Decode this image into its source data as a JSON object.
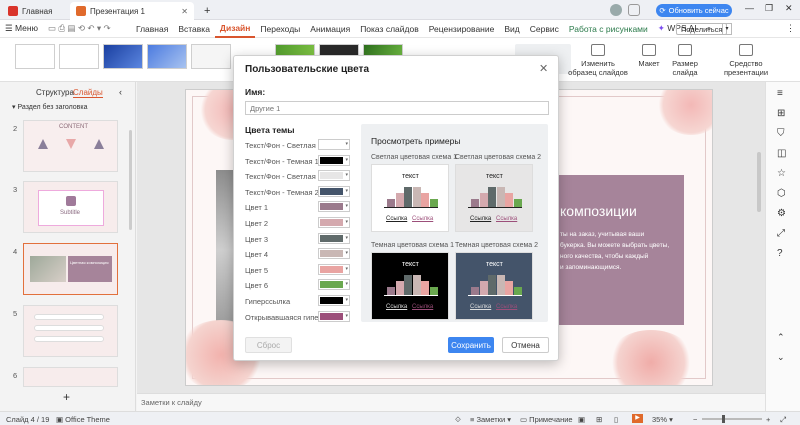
{
  "titlebar": {
    "home_tab": "Главная",
    "doc_tab": "Презентация 1",
    "update_button": "Обновить сейчас",
    "share_button": "Поделиться"
  },
  "menubar": {
    "menu_label": "Меню",
    "items": [
      "Главная",
      "Вставка",
      "Дизайн",
      "Переходы",
      "Анимация",
      "Показ слайдов",
      "Рецензирование",
      "Вид",
      "Сервис",
      "Работа с рисунками",
      "WPS AI"
    ]
  },
  "ribbon": {
    "change_scheme": "Изменить образец слайдов",
    "layout": "Макет",
    "slide_size": "Размер слайда",
    "presentation_tools": "Средство презентации"
  },
  "leftpanel": {
    "tab_structure": "Структура",
    "tab_slides": "Слайды",
    "section": "Раздел без заголовка",
    "slides": [
      {
        "num": "2",
        "title": "CONTENT"
      },
      {
        "num": "3",
        "title": "Subtitle"
      },
      {
        "num": "4",
        "title": "Цветная композиция"
      },
      {
        "num": "5",
        "title": ""
      },
      {
        "num": "6",
        "title": ""
      }
    ]
  },
  "slide": {
    "heading": "композиции",
    "body_lines": [
      "ты на заказ, учитывая ваши",
      "букерка. Вы можете выбрать цветы,",
      "ного качества, чтобы каждый",
      "и запоминающимся."
    ]
  },
  "notes_placeholder": "Заметки к слайду",
  "status": {
    "slide_info": "Слайд 4 / 19",
    "theme": "Office Theme",
    "notes_btn": "Заметки",
    "comment_btn": "Примечание",
    "zoom": "35%"
  },
  "dialog": {
    "title": "Пользовательские цвета",
    "name_label": "Имя:",
    "name_placeholder": "Другие 1",
    "theme_colors_label": "Цвета темы",
    "preview_label": "Просмотреть примеры",
    "colors": [
      {
        "label": "Текст/Фон - Светлая 1",
        "color": "#ffffff"
      },
      {
        "label": "Текст/Фон - Темная 1",
        "color": "#000000"
      },
      {
        "label": "Текст/Фон - Светлая 2",
        "color": "#e7e6e6"
      },
      {
        "label": "Текст/Фон - Темная 2",
        "color": "#44546a"
      },
      {
        "label": "Цвет 1",
        "color": "#9b7a8c"
      },
      {
        "label": "Цвет 2",
        "color": "#d4a9ae"
      },
      {
        "label": "Цвет 3",
        "color": "#5f6a6a"
      },
      {
        "label": "Цвет 4",
        "color": "#c9b7b4"
      },
      {
        "label": "Цвет 5",
        "color": "#e9a4a2"
      },
      {
        "label": "Цвет 6",
        "color": "#6aa84f"
      },
      {
        "label": "Гиперссылка",
        "color": "#000000"
      },
      {
        "label": "Открывавшаяся гиперс...",
        "color": "#9c4f7a"
      }
    ],
    "previews": [
      {
        "title": "Светлая цветовая схема 1",
        "text": "текст",
        "link": "Ссылка",
        "visited": "Ссылка"
      },
      {
        "title": "Светлая цветовая схема 2",
        "text": "текст",
        "link": "Ссылка",
        "visited": "Ссылка"
      },
      {
        "title": "Темная цветовая схема 1",
        "text": "текст",
        "link": "Ссылка",
        "visited": "Ссылка"
      },
      {
        "title": "Темная цветовая схема 2",
        "text": "текст",
        "link": "Ссылка",
        "visited": "Ссылка"
      }
    ],
    "reset_button": "Сброс",
    "save_button": "Сохранить",
    "cancel_button": "Отмена"
  }
}
